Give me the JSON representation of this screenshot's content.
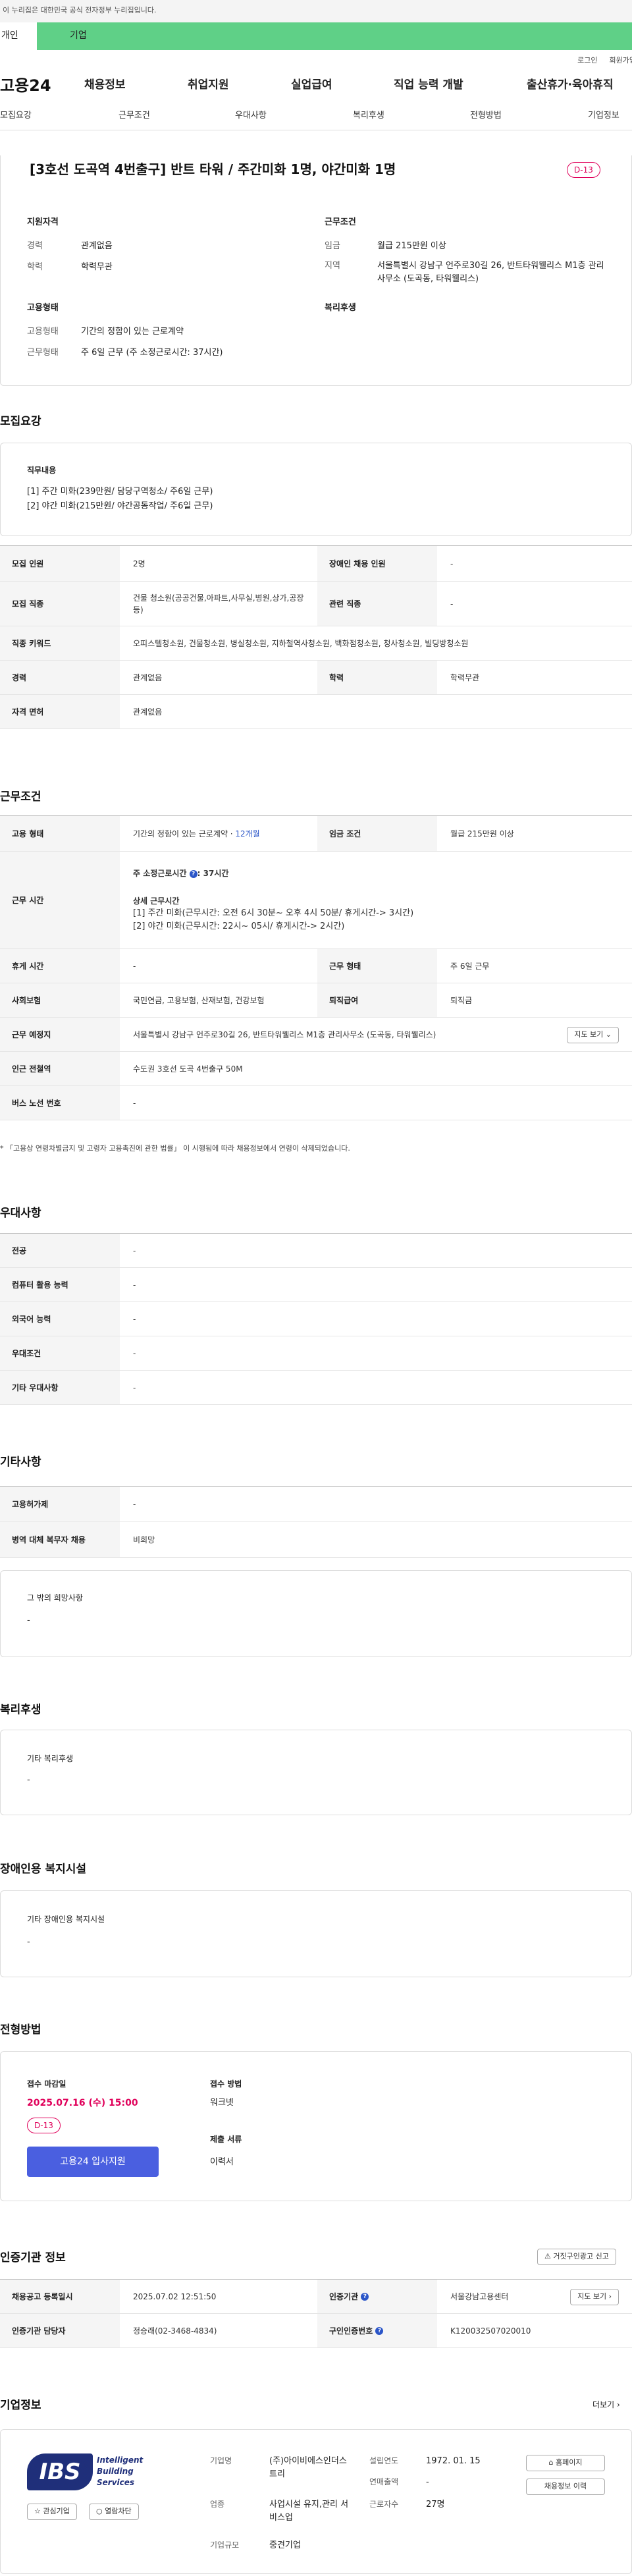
{
  "gov_notice": "이 누리집은 대한민국 공식 전자정부 누리집입니다.",
  "top_tabs": [
    "개인",
    "기업"
  ],
  "util": [
    "로그인",
    "회원가입"
  ],
  "logo": "고용24",
  "gnb": [
    "채용정보",
    "취업지원",
    "실업급여",
    "직업 능력 개발",
    "출산휴가·육아휴직"
  ],
  "subtabs": [
    "모집요강",
    "근무조건",
    "우대사항",
    "복리후생",
    "전형방법",
    "기업정보"
  ],
  "header": {
    "title": "[3호선 도곡역 4번출구] 반트 타워 / 주간미화 1명, 야간미화 1명",
    "dday": "D-13"
  },
  "summary": {
    "req_title": "지원자격",
    "career_label": "경력",
    "career": "관계없음",
    "edu_label": "학력",
    "edu": "학력무관",
    "cond_title": "근무조건",
    "wage_label": "임금",
    "wage": "월급 215만원 이상",
    "region_label": "지역",
    "region": "서울특별시 강남구 언주로30길 26, 반트타워웰리스 M1층 관리사무소 (도곡동, 타워웰리스)",
    "emp_title": "고용형태",
    "emp_label": "고용형태",
    "emp": "기간의 정함이 있는 근로계약",
    "work_label": "근무형태",
    "work": "주 6일 근무 (주 소정근로시간: 37시간)",
    "welfare_title": "복리후생"
  },
  "recruit": {
    "title": "모집요강",
    "job_title": "직무내용",
    "job_lines": [
      "[1] 주간 미화(239만원/ 담당구역청소/ 주6일 근무)",
      "[2] 야간 미화(215만원/ 야간공동작업/ 주6일 근무)"
    ],
    "rows": [
      {
        "th": "모집 인원",
        "td": "2명",
        "th2": "장애인 채용 인원",
        "td2": "-"
      },
      {
        "th": "모집 직종",
        "td": "건물 청소원(공공건물,아파트,사무실,병원,상가,공장 등)",
        "th2": "관련 직종",
        "td2": "-"
      },
      {
        "th": "직종 키워드",
        "td": "오피스텔청소원, 건물청소원, 병실청소원, 지하철역사청소원, 백화점청소원, 청사청소원, 빌딩방청소원"
      },
      {
        "th": "경력",
        "td": "관계없음",
        "th2": "학력",
        "td2": "학력무관"
      },
      {
        "th": "자격 면허",
        "td": "관계없음"
      }
    ]
  },
  "work": {
    "title": "근무조건",
    "emp_type_th": "고용 형태",
    "emp_type_td": "기간의 정함이 있는 근로계약 · ",
    "emp_type_link": "12개월",
    "wage_th": "임금 조건",
    "wage_td": "월급 215만원 이상",
    "hours_th": "근무 시간",
    "hours_main": "주 소정근로시간 ",
    "hours_val": ": 37시간",
    "hours_detail_title": "상세 근무시간",
    "hours_lines": [
      "[1] 주간 미화(근무시간: 오전 6시 30분~ 오후 4시 50분/ 휴게시간-> 3시간)",
      "[2] 야간 미화(근무시간: 22시~ 05시/ 휴게시간-> 2시간)"
    ],
    "rest_th": "휴게 시간",
    "rest_td": "-",
    "worktype_th": "근무 형태",
    "worktype_td": "주 6일 근무",
    "ins_th": "사회보험",
    "ins_td": "국민연금, 고용보험, 산재보험, 건강보험",
    "sev_th": "퇴직급여",
    "sev_td": "퇴직금",
    "place_th": "근무 예정지",
    "place_td": "서울특별시 강남구 언주로30길 26, 반트타워웰리스 M1층 관리사무소 (도곡동, 타워웰리스)",
    "map_btn": "지도 보기",
    "subway_th": "인근 전철역",
    "subway_td": "수도권 3호선 도곡 4번출구 50M",
    "bus_th": "버스 노선 번호",
    "bus_td": "-",
    "note": "* 「고용상 연령차별금지 및 고령자 고용촉진에 관한 법률」 이 시행됨에 따라 채용정보에서 연령이 삭제되었습니다."
  },
  "pref": {
    "title": "우대사항",
    "rows": [
      [
        "전공",
        "-"
      ],
      [
        "컴퓨터 활용 능력",
        "-"
      ],
      [
        "외국어 능력",
        "-"
      ],
      [
        "우대조건",
        "-"
      ],
      [
        "기타 우대사항",
        "-"
      ]
    ]
  },
  "etc": {
    "title": "기타사항",
    "rows": [
      [
        "고용허가제",
        "-"
      ],
      [
        "병역 대체 복무자 채용",
        "비희망"
      ]
    ],
    "other_title": "그 밖의 희망사항",
    "other_val": "-"
  },
  "welfare": {
    "title": "복리후생",
    "sub": "기타 복리후생",
    "val": "-"
  },
  "disabled": {
    "title": "장애인용 복지시설",
    "sub": "기타 장애인용 복지시설",
    "val": "-"
  },
  "process": {
    "title": "전형방법",
    "deadline_label": "접수 마감일",
    "deadline": "2025.07.16 (수) 15:00",
    "dday": "D-13",
    "apply_btn": "고용24 입사지원",
    "method_label": "접수 방법",
    "method": "워크넷",
    "docs_label": "제출 서류",
    "docs": "이력서"
  },
  "agency": {
    "title": "인증기관 정보",
    "report_btn": "거짓구인광고 신고",
    "reg_th": "채용공고 등록일시",
    "reg_td": "2025.07.02 12:51:50",
    "org_th": "인증기관",
    "org_td": "서울강남고용센터",
    "map_btn": "지도 보기",
    "mgr_th": "인증기관 담당자",
    "mgr_td": "정승래(02-3468-4834)",
    "num_th": "구인인증번호",
    "num_td": "K120032507020010"
  },
  "company": {
    "title": "기업정보",
    "more": "더보기",
    "logo_ibs": "IBS",
    "logo_l1": "Intelligent",
    "logo_l2": "Building",
    "logo_l3": "Services",
    "interest_btn": "관심기업",
    "block_btn": "열람차단",
    "name_label": "기업명",
    "name": "(주)아이비에스인더스트리",
    "industry_label": "업종",
    "industry": "사업시설 유지,관리 서비스업",
    "size_label": "기업규모",
    "size": "중견기업",
    "founded_label": "설립연도",
    "founded": "1972. 01. 15",
    "sales_label": "연매출액",
    "sales": "-",
    "emp_label": "근로자수",
    "emp": "27명",
    "home_btn": "홈페이지",
    "history_btn": "채용정보 이력"
  }
}
